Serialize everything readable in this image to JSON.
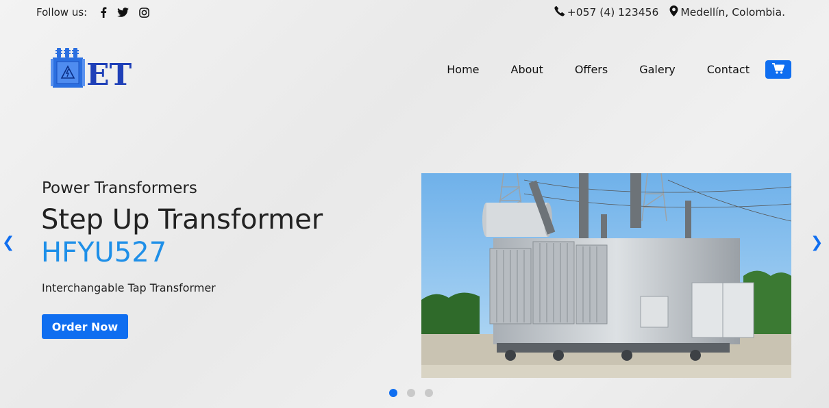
{
  "topbar": {
    "follow_label": "Follow us:",
    "social_icons": [
      "facebook-icon",
      "twitter-icon",
      "instagram-icon"
    ],
    "phone": "+057 (4) 123456",
    "location": "Medellín, Colombia."
  },
  "logo": {
    "text": "ET"
  },
  "nav": {
    "items": [
      "Home",
      "About",
      "Offers",
      "Galery",
      "Contact"
    ],
    "cart_icon": "shopping-cart-icon"
  },
  "hero": {
    "subtitle": "Power Transformers",
    "title": "Step Up Transformer",
    "model": "HFYU527",
    "description": "Interchangable Tap Transformer",
    "button_label": "Order Now",
    "prev_arrow": "❮",
    "next_arrow": "❯"
  },
  "carousel": {
    "slides": 3,
    "active": 1
  },
  "colors": {
    "accent": "#0f6ef0",
    "model": "#1e8fe8",
    "text": "#222222"
  }
}
